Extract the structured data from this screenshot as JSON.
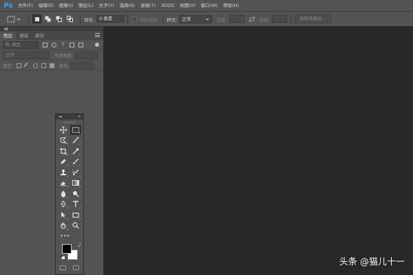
{
  "app": {
    "logo": "Ps",
    "menu": [
      "文件(F)",
      "编辑(E)",
      "图像(I)",
      "图层(L)",
      "文字(Y)",
      "选择(S)",
      "滤镜(T)",
      "3D(D)",
      "视图(V)",
      "窗口(W)",
      "帮助(H)"
    ]
  },
  "options": {
    "feather_label": "羽化:",
    "feather_value": "0 像素",
    "antialias_label": "消除锯齿",
    "style_label": "样式:",
    "style_value": "正常",
    "width_label": "宽度:",
    "height_label": "高度:",
    "select_mask_label": "选择并遮住..."
  },
  "layers_panel": {
    "tabs": [
      "图层",
      "通道",
      "路径"
    ],
    "filter_placeholder": "类型",
    "blend_mode": "正常",
    "opacity_label": "不透明度:",
    "lock_label": "锁定:",
    "fill_label": "填充:"
  },
  "tools": {
    "more_label": "•••",
    "fg_color": "#000000",
    "bg_color": "#ffffff"
  },
  "watermark": "头条 @猫儿十一",
  "colors": {
    "accent": "#31a8ff",
    "ui_bg": "#535353",
    "canvas_bg": "#282828"
  }
}
